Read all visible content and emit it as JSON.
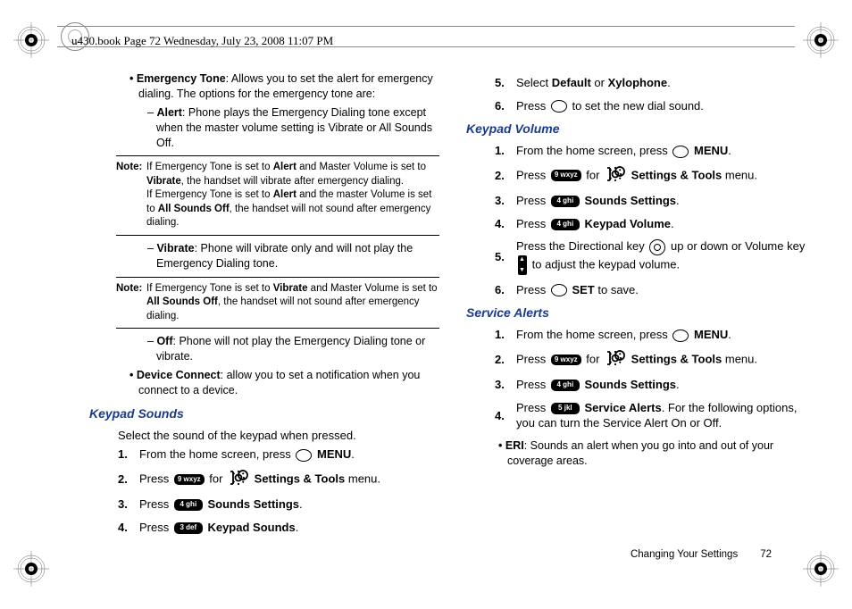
{
  "header": "u430.book  Page 72  Wednesday, July 23, 2008  11:07 PM",
  "left": {
    "emergency_tone_label": "Emergency Tone",
    "emergency_tone_text": ": Allows you to set the alert for emergency dialing. The options for the emergency tone are:",
    "alert_label": "Alert",
    "alert_text": ": Phone plays the Emergency Dialing tone except when the master volume setting is Vibrate or All Sounds Off.",
    "note1_label": "Note:",
    "note1_text_a": "If Emergency Tone is set to ",
    "note1_alert": "Alert",
    "note1_text_b": " and Master Volume is set to ",
    "note1_vibrate": "Vibrate",
    "note1_text_c": ", the handset will vibrate after emergency dialing.",
    "note1_text_d": "If Emergency Tone is set to ",
    "note1_alert2": "Alert",
    "note1_text_e": " and the master Volume is set to ",
    "note1_aso": "All Sounds Off",
    "note1_text_f": ", the handset will not sound after emergency dialing.",
    "vibrate_label": "Vibrate",
    "vibrate_text": ": Phone will vibrate only and will not play the Emergency Dialing tone.",
    "note2_label": "Note:",
    "note2_text_a": "If Emergency Tone is set to ",
    "note2_vibrate": "Vibrate",
    "note2_text_b": " and Master Volume is set to ",
    "note2_aso": "All Sounds Off",
    "note2_text_c": ", the handset will not sound after emergency dialing.",
    "off_label": "Off",
    "off_text": ": Phone will not play the Emergency Dialing tone or vibrate.",
    "device_connect_label": "Device Connect",
    "device_connect_text": ": allow you to set a notification when you connect to a device.",
    "heading_keypad_sounds": "Keypad Sounds",
    "keypad_sounds_intro": "Select the sound of the keypad when pressed.",
    "s1_num": "1.",
    "s1_a": "From the home screen, press ",
    "s1_b": " MENU",
    "s1_c": ".",
    "s2_num": "2.",
    "s2_a": "Press ",
    "key9": "9 wxyz",
    "s2_b": " for ",
    "s2_c": " Settings & Tools",
    "s2_d": " menu.",
    "s3_num": "3.",
    "s3_a": "Press ",
    "key4": "4 ghi",
    "s3_b": " Sounds Settings",
    "s3_c": ".",
    "s4_num": "4.",
    "s4_a": "Press ",
    "key3": "3 def",
    "s4_b": " Keypad Sounds",
    "s4_c": "."
  },
  "right": {
    "s5_num": "5.",
    "s5_a": "Select ",
    "s5_b": "Default",
    "s5_c": " or ",
    "s5_d": "Xylophone",
    "s5_e": ".",
    "s6_num": "6.",
    "s6_a": "Press ",
    "s6_b": " to set the new dial sound.",
    "heading_keypad_volume": "Keypad Volume",
    "kv1_num": "1.",
    "kv1_a": "From the home screen, press ",
    "kv1_b": " MENU",
    "kv1_c": ".",
    "kv2_num": "2.",
    "kv2_a": "Press ",
    "kv2_b": " for ",
    "kv2_c": " Settings & Tools",
    "kv2_d": " menu.",
    "kv3_num": "3.",
    "kv3_a": "Press ",
    "kv3_b": " Sounds Settings",
    "kv3_c": ".",
    "kv4_num": "4.",
    "kv4_a": "Press ",
    "kv4_b": " Keypad Volume",
    "kv4_c": ".",
    "kv5_num": "5.",
    "kv5_a": "Press the Directional key ",
    "kv5_b": " up or down or Volume key ",
    "kv5_c": " to adjust the keypad volume.",
    "kv6_num": "6.",
    "kv6_a": "Press ",
    "kv6_b": " SET",
    "kv6_c": " to save.",
    "heading_service_alerts": "Service Alerts",
    "sa1_num": "1.",
    "sa1_a": "From the home screen, press ",
    "sa1_b": " MENU",
    "sa1_c": ".",
    "sa2_num": "2.",
    "sa2_a": "Press ",
    "sa2_b": " for ",
    "sa2_c": " Settings & Tools",
    "sa2_d": " menu.",
    "sa3_num": "3.",
    "sa3_a": "Press ",
    "sa3_b": " Sounds Settings",
    "sa3_c": ".",
    "sa4_num": "4.",
    "sa4_a": "Press ",
    "key5": "5 jkl",
    "sa4_b": " Service Alerts",
    "sa4_c": ". For the following options, you can turn the Service Alert On or Off.",
    "eri_label": "ERI",
    "eri_text": ": Sounds an alert when you go into and out of your coverage areas."
  },
  "footer": {
    "section": "Changing Your Settings",
    "page": "72"
  }
}
